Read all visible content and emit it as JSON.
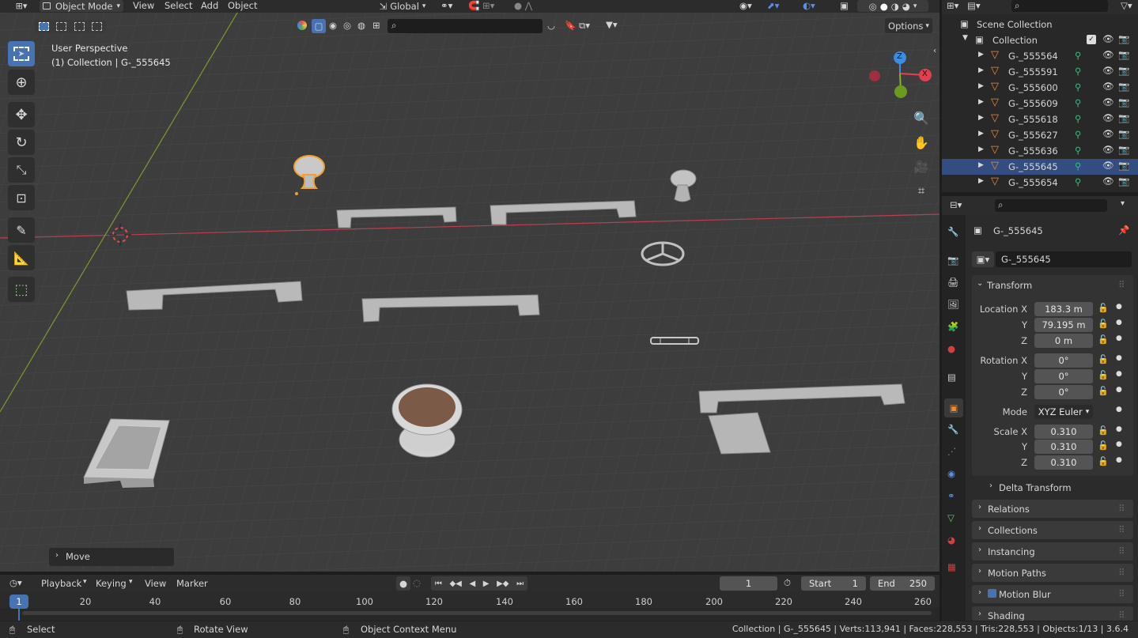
{
  "header": {
    "mode": "Object Mode",
    "menus": [
      "View",
      "Select",
      "Add",
      "Object"
    ],
    "orientation": "Global",
    "options_label": "Options"
  },
  "viewport": {
    "perspective_label": "User Perspective",
    "collection_label": "(1) Collection | G-_555645",
    "last_operator": "Move",
    "gizmo": {
      "z": "Z",
      "x": "X"
    }
  },
  "outliner": {
    "scene_collection": "Scene Collection",
    "collection": "Collection",
    "items": [
      "G-_555564",
      "G-_555591",
      "G-_555600",
      "G-_555609",
      "G-_555618",
      "G-_555627",
      "G-_555636",
      "G-_555645",
      "G-_555654"
    ],
    "selected": "G-_555645"
  },
  "properties": {
    "object_name": "G-_555645",
    "data_name": "G-_555645",
    "transform_title": "Transform",
    "location_label": "Location X",
    "location": {
      "x": "183.3 m",
      "y": "79.195 m",
      "z": "0 m"
    },
    "rotation_label": "Rotation X",
    "rotation": {
      "x": "0°",
      "y": "0°",
      "z": "0°"
    },
    "mode_label": "Mode",
    "mode_value": "XYZ Euler",
    "scale_label": "Scale X",
    "scale": {
      "x": "0.310",
      "y": "0.310",
      "z": "0.310"
    },
    "axis_y": "Y",
    "axis_z": "Z",
    "delta_transform": "Delta Transform",
    "panels": [
      "Relations",
      "Collections",
      "Instancing",
      "Motion Paths",
      "Motion Blur",
      "Shading"
    ]
  },
  "timeline": {
    "menus": [
      "Playback",
      "Keying",
      "View",
      "Marker"
    ],
    "current_frame": "1",
    "start_label": "Start",
    "start_value": "1",
    "end_label": "End",
    "end_value": "250",
    "ruler": [
      "1",
      "20",
      "40",
      "60",
      "80",
      "100",
      "120",
      "140",
      "160",
      "180",
      "200",
      "220",
      "240",
      "260"
    ]
  },
  "statusbar": {
    "select": "Select",
    "rotate": "Rotate View",
    "context": "Object Context Menu",
    "stats": "Collection | G-_555645 | Verts:113,941 | Faces:228,553 | Tris:228,553 | Objects:1/13 | 3.6.4"
  },
  "colors": {
    "accent": "#4772b3",
    "selected_outline": "#f0a030",
    "x_axis": "#e04050",
    "y_axis": "#88b030",
    "z_axis": "#3a8de0"
  }
}
